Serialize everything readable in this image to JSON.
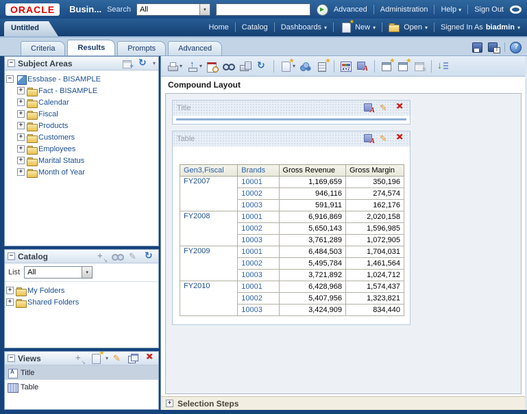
{
  "topbar": {
    "logo": "ORACLE",
    "app_title": "Busin...",
    "search_label": "Search",
    "search_scope": "All",
    "search_value": "",
    "advanced": "Advanced",
    "administration": "Administration",
    "help": "Help",
    "sign_out": "Sign Out"
  },
  "navbar": {
    "document_tab": "Untitled",
    "home": "Home",
    "catalog": "Catalog",
    "dashboards": "Dashboards",
    "new_label": "New",
    "open_label": "Open",
    "signed_in_label": "Signed In As",
    "user": "biadmin"
  },
  "tabstrip": {
    "tabs": [
      "Criteria",
      "Results",
      "Prompts",
      "Advanced"
    ],
    "active": "Results"
  },
  "sidebar": {
    "subject_areas": {
      "title": "Subject Areas",
      "root": "Essbase - BISAMPLE",
      "folders": [
        "Fact - BISAMPLE",
        "Calendar",
        "Fiscal",
        "Products",
        "Customers",
        "Employees",
        "Marital Status",
        "Month of Year"
      ]
    },
    "catalog": {
      "title": "Catalog",
      "list_label": "List",
      "list_value": "All",
      "folders": [
        "My Folders",
        "Shared Folders"
      ]
    },
    "views": {
      "title": "Views",
      "items": [
        {
          "label": "Title",
          "selected": true
        },
        {
          "label": "Table",
          "selected": false
        }
      ]
    }
  },
  "main": {
    "compound_layout": "Compound Layout",
    "title_view": "Title",
    "table_view": "Table",
    "selection_steps": "Selection Steps",
    "toolbar_icons": [
      "print",
      "export",
      "schedule",
      "preview",
      "print-options",
      "refresh",
      "new-view",
      "new-group",
      "new-calculated-item",
      "edit-formulas",
      "import-formatting",
      "new-master-detail",
      "duplicate-view",
      "delete-view",
      "sort"
    ],
    "table": {
      "columns": [
        "Gen3,Fiscal",
        "Brands",
        "Gross Revenue",
        "Gross Margin"
      ],
      "groups": [
        {
          "fiscal": "FY2007",
          "rows": [
            [
              "10001",
              "1,169,659",
              "350,196"
            ],
            [
              "10002",
              "946,116",
              "274,574"
            ],
            [
              "10003",
              "591,911",
              "162,176"
            ]
          ]
        },
        {
          "fiscal": "FY2008",
          "rows": [
            [
              "10001",
              "6,916,869",
              "2,020,158"
            ],
            [
              "10002",
              "5,650,143",
              "1,596,985"
            ],
            [
              "10003",
              "3,761,289",
              "1,072,905"
            ]
          ]
        },
        {
          "fiscal": "FY2009",
          "rows": [
            [
              "10001",
              "6,484,503",
              "1,704,031"
            ],
            [
              "10002",
              "5,495,784",
              "1,461,564"
            ],
            [
              "10003",
              "3,721,892",
              "1,024,712"
            ]
          ]
        },
        {
          "fiscal": "FY2010",
          "rows": [
            [
              "10001",
              "6,428,968",
              "1,574,437"
            ],
            [
              "10002",
              "5,407,956",
              "1,323,821"
            ],
            [
              "10003",
              "3,424,909",
              "834,440"
            ]
          ]
        }
      ]
    }
  },
  "colors": {
    "topbar_blue": "#1b4c86",
    "accent_blue": "#2b62a8",
    "link_blue": "#1b4f91",
    "tab_strip": "#c2d4e6",
    "table_header_bg": "#eeeee2",
    "selection_bar_bg": "#f2eee1",
    "delete_red": "#cf1d1d",
    "pencil_orange": "#e8921c",
    "title_rule_blue": "#8cb0d8"
  }
}
